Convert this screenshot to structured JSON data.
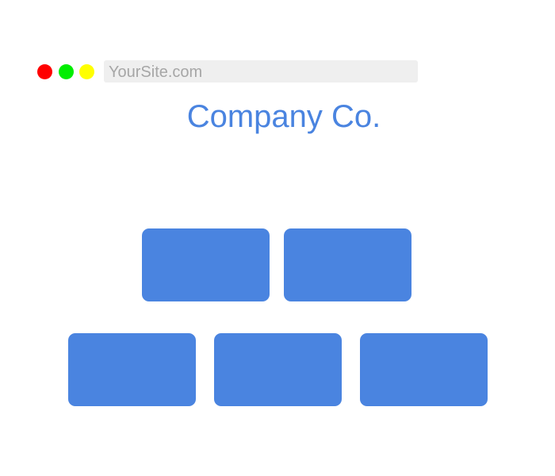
{
  "window_controls": {
    "close_color": "#ff0000",
    "minimize_color": "#00ee00",
    "maximize_color": "#ffff00"
  },
  "address_bar": {
    "url": "YourSite.com"
  },
  "page": {
    "title": "Company Co.",
    "title_color": "#4a84e0"
  },
  "tiles": {
    "color": "#4a84e0",
    "count": 5
  }
}
